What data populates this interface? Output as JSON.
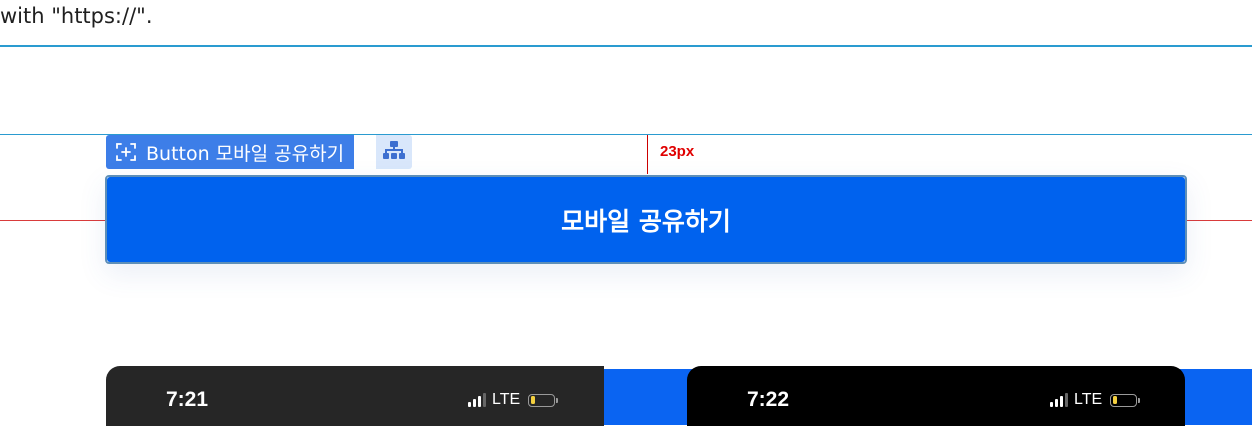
{
  "header": {
    "fragment_text": "with \"https://\"."
  },
  "inspector": {
    "component_tag_label": "Button 모바일 공유하기",
    "measure_label": "23px"
  },
  "main": {
    "share_button_label": "모바일 공유하기"
  },
  "phones": [
    {
      "time": "7:21",
      "network": "LTE",
      "battery_level": 0.2
    },
    {
      "time": "7:22",
      "network": "LTE",
      "battery_level": 0.2
    }
  ],
  "colors": {
    "button_blue": "#0062ee",
    "tag_blue": "#3d7ee8",
    "guide_blue": "#2a9bd0",
    "measure_red": "#e00000"
  },
  "icons": {
    "component_tag": "component-select-icon",
    "tree": "hierarchy-tree-icon"
  }
}
